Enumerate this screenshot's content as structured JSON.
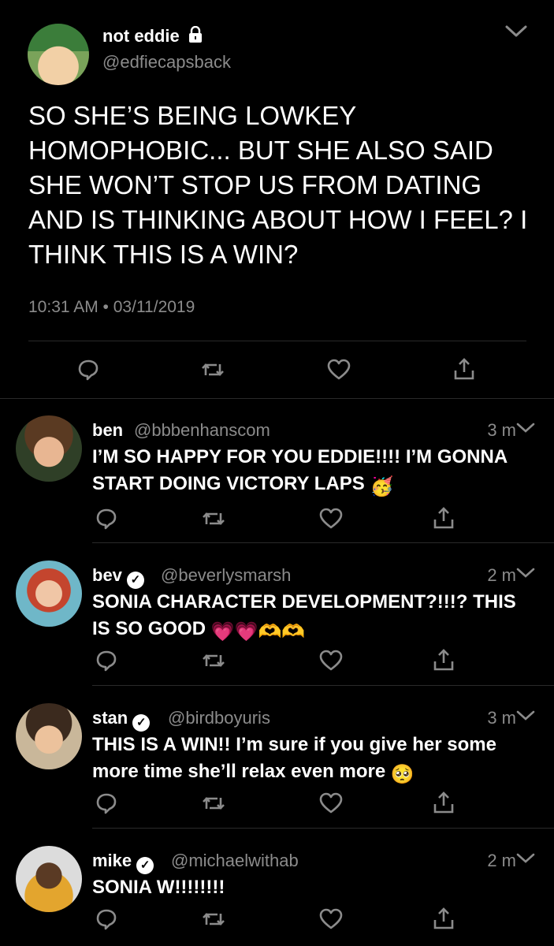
{
  "main_tweet": {
    "display_name": "not eddie",
    "handle": "@edfiecapsback",
    "text": "SO SHE’S BEING LOWKEY HOMOPHOBIC... BUT SHE ALSO SAID SHE WON’T STOP US FROM DATING AND IS THINKING ABOUT HOW I FEEL? I THINK THIS IS A WIN?",
    "timestamp": "10:31 AM • 03/11/2019",
    "icons": [
      "reply-icon",
      "retweet-icon",
      "like-icon",
      "share-icon",
      "lock-icon",
      "chevron-down-icon"
    ]
  },
  "replies": [
    {
      "display_name": "ben",
      "handle": "@bbbenhanscom",
      "time": "3 m",
      "text": "I’M SO HAPPY FOR YOU EDDIE!!!! I’M GONNA START DOING VICTORY LAPS",
      "emoji": "🥳",
      "verified": false
    },
    {
      "display_name": "bev",
      "handle": "@beverlysmarsh",
      "time": "2 m",
      "text": "SONIA CHARACTER DEVELOPMENT?!!!? THIS IS SO GOOD",
      "emoji": "💗💗🫶🫶",
      "verified": true
    },
    {
      "display_name": "stan",
      "handle": "@birdboyuris",
      "time": "3 m",
      "text": "THIS IS A WIN!! I’m sure if you give her some more time she’ll relax even more",
      "emoji": "🥺",
      "verified": true
    },
    {
      "display_name": "mike",
      "handle": "@michaelwithab",
      "time": "2 m",
      "text": "SONIA W!!!!!!!!",
      "emoji": "",
      "verified": true
    }
  ],
  "colors": {
    "background": "#000000",
    "text": "#ffffff",
    "muted": "#8b8b8b",
    "divider": "#2a2a2a"
  }
}
